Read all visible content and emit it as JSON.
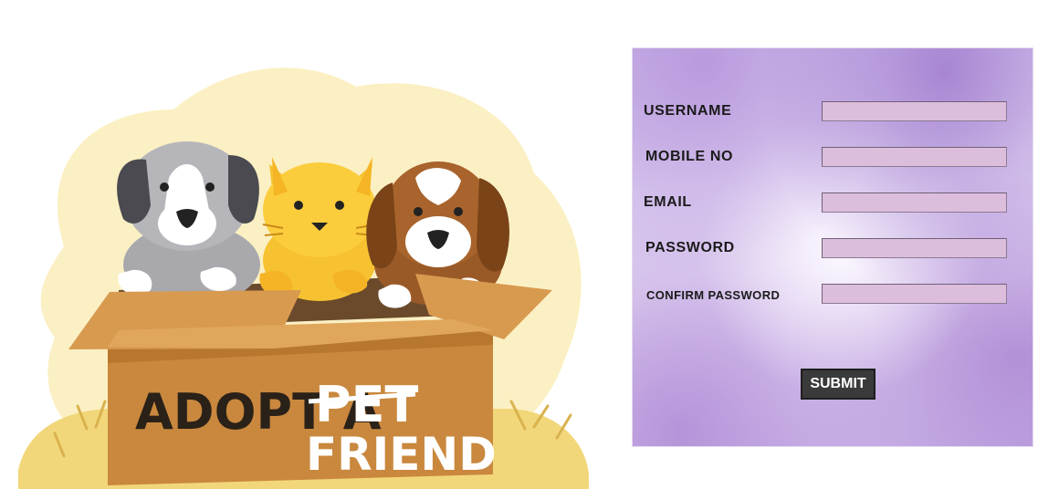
{
  "illustration": {
    "sign_line1": "ADOPT A",
    "sign_struck": "PET",
    "sign_line2": "FRIEND"
  },
  "form": {
    "fields": [
      {
        "label": "USERNAME",
        "value": ""
      },
      {
        "label": "MOBILE NO",
        "value": ""
      },
      {
        "label": "EMAIL",
        "value": ""
      },
      {
        "label": "PASSWORD",
        "value": ""
      },
      {
        "label": "CONFIRM PASSWORD",
        "value": ""
      }
    ],
    "submit_label": "SUBMIT"
  },
  "colors": {
    "input_fill": "#dcbedc",
    "button_fill": "#3a3a3a",
    "panel_accent": "#c6afe6"
  }
}
